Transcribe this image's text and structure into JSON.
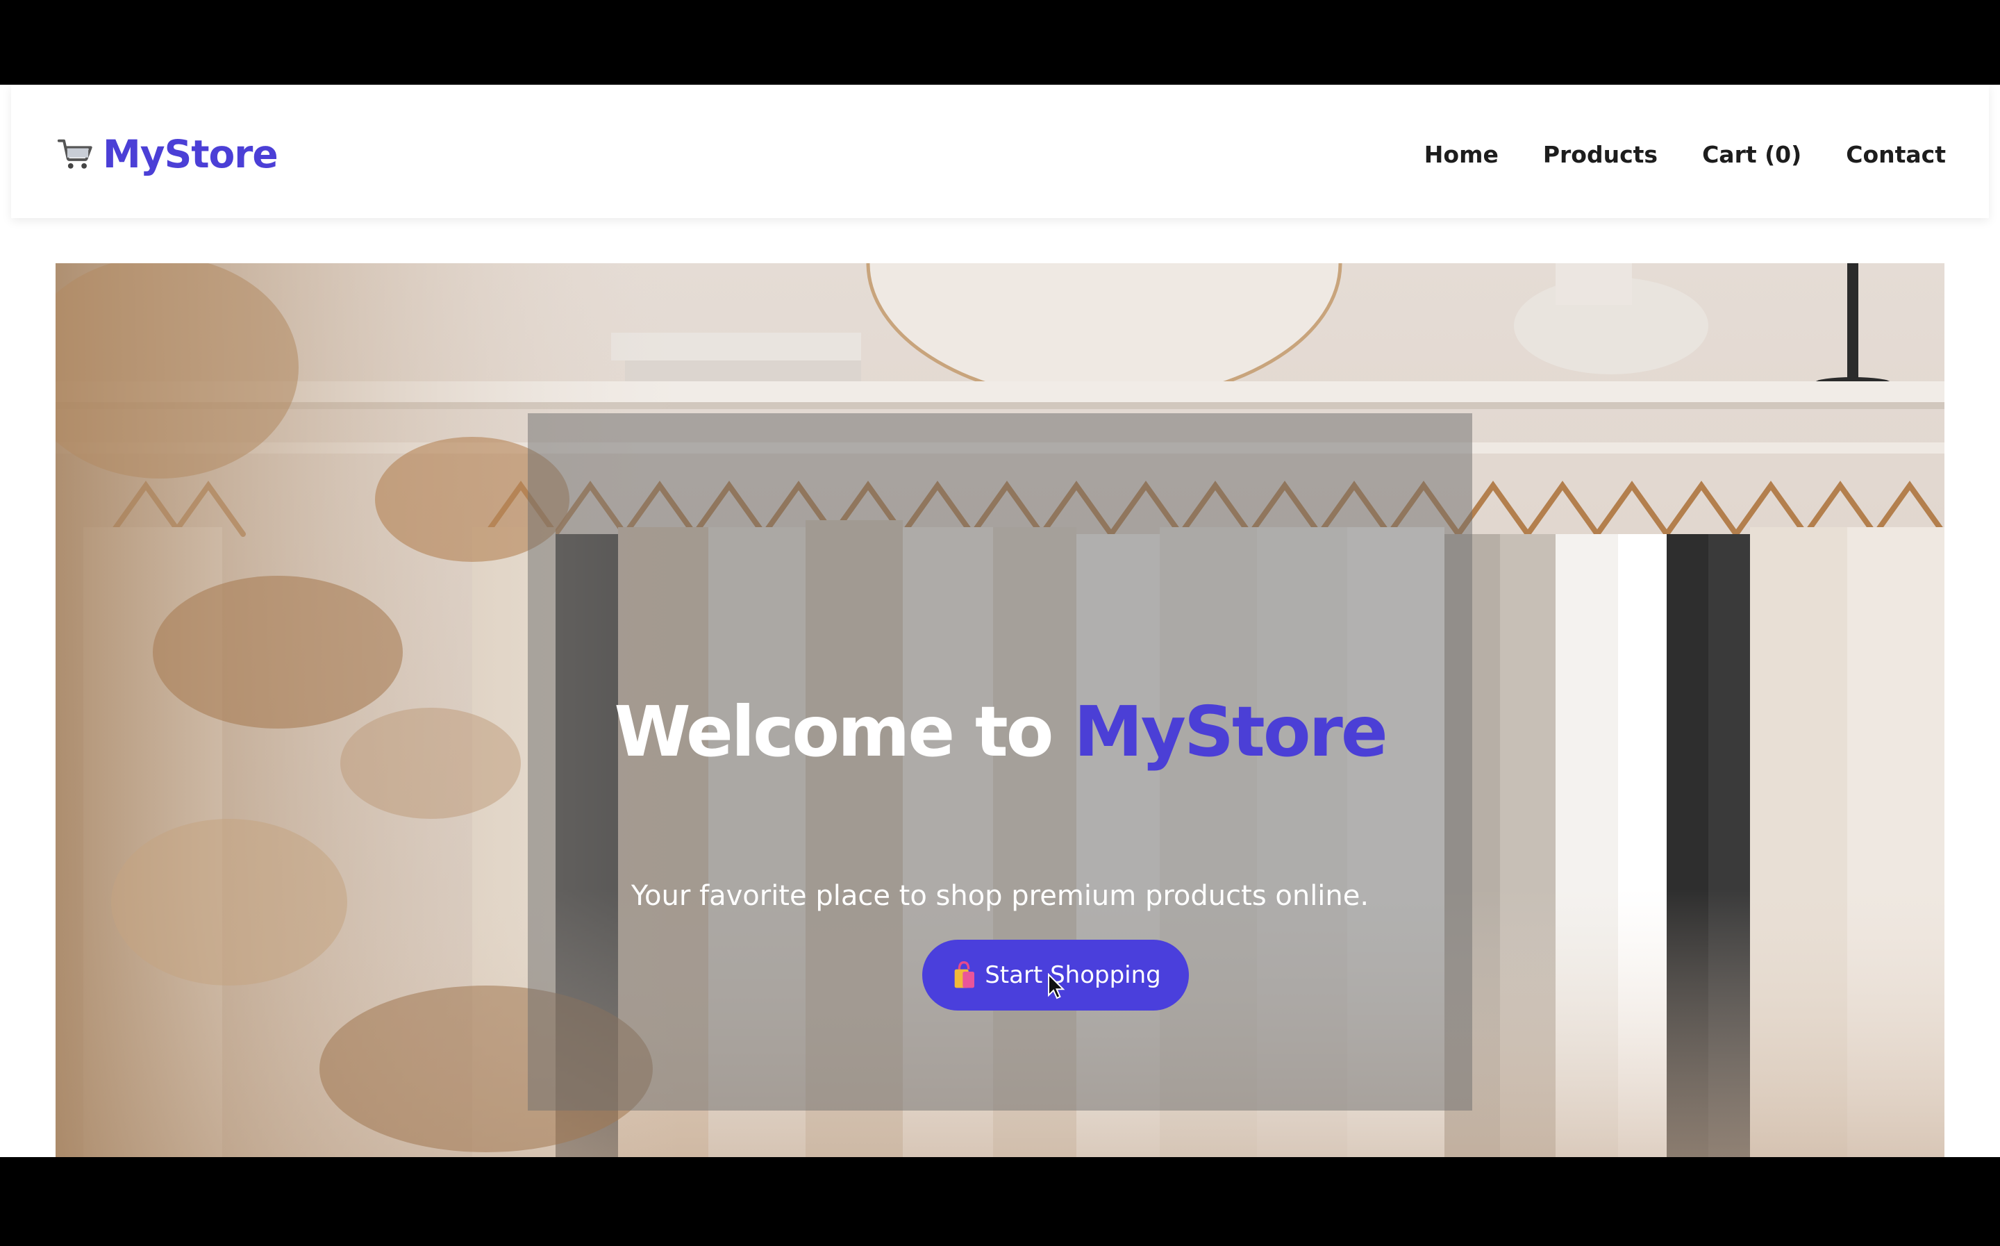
{
  "header": {
    "logo_icon": "shopping-cart-icon",
    "logo_text": "MyStore",
    "nav": [
      {
        "label": "Home"
      },
      {
        "label": "Products"
      },
      {
        "label": "Cart (0)"
      },
      {
        "label": "Contact"
      }
    ]
  },
  "hero": {
    "title_prefix": "Welcome to ",
    "title_brand": "MyStore",
    "subtitle": "Your favorite place to shop premium products online.",
    "cta_icon": "shopping-bags-icon",
    "cta_label": "Start Shopping",
    "background_icon": "clothing-rack-photo"
  },
  "colors": {
    "brand": "#4b3fd6",
    "cta_background": "#4a3fdc",
    "nav_text": "#1d1d1d",
    "frame": "#000000"
  }
}
